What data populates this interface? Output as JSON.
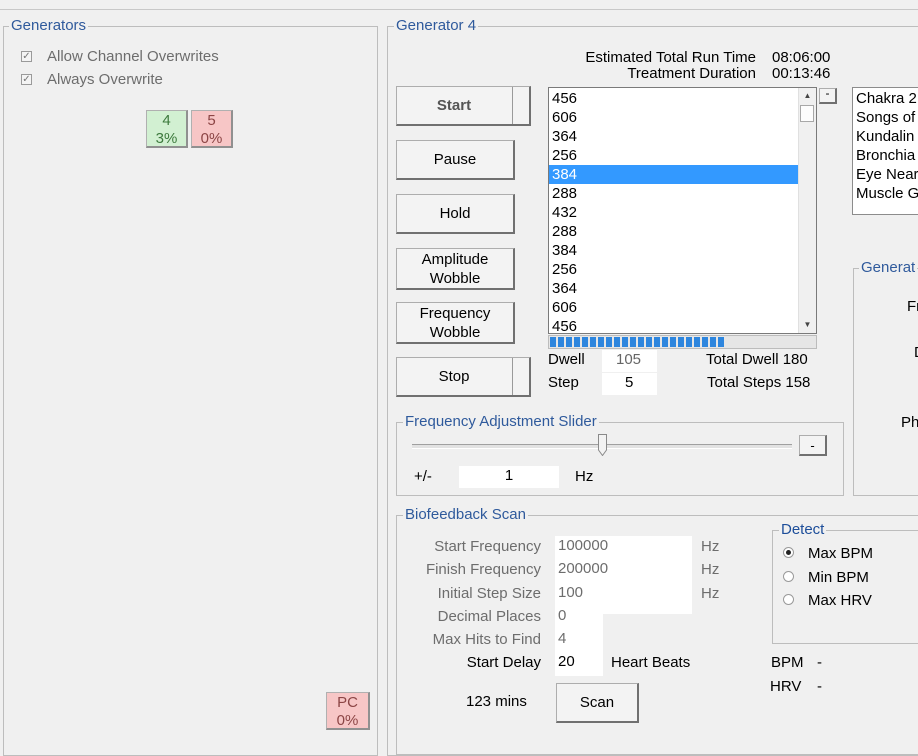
{
  "left_panel": {
    "title": "Generators",
    "checkboxes": [
      {
        "label": "Allow Channel Overwrites",
        "checked": true
      },
      {
        "label": "Always Overwrite",
        "checked": true
      }
    ],
    "channel_tiles": [
      {
        "num": "4",
        "pct": "3%",
        "color": "#d2f0d2"
      },
      {
        "num": "5",
        "pct": "0%",
        "color": "#f7c6c6"
      }
    ],
    "pc_tile": {
      "num": "PC",
      "pct": "0%"
    }
  },
  "generator": {
    "title": "Generator 4",
    "estimated_label": "Estimated Total Run Time",
    "estimated_value": "08:06:00",
    "duration_label": "Treatment Duration",
    "duration_value": "00:13:46",
    "buttons": {
      "start": "Start",
      "pause": "Pause",
      "hold": "Hold",
      "amp_line1": "Amplitude",
      "amp_line2": "Wobble",
      "freq_line1": "Frequency",
      "freq_line2": "Wobble",
      "stop": "Stop"
    },
    "frequency_list": [
      "456",
      "606",
      "364",
      "256",
      "384",
      "288",
      "432",
      "288",
      "384",
      "256",
      "364",
      "606",
      "456"
    ],
    "selected_index": 4,
    "minus_button": "-",
    "programs": [
      "Chakra 2",
      "Songs of",
      "Kundalin",
      "Bronchia",
      "Eye Near",
      "Muscle G"
    ],
    "progress_fraction": 0.66,
    "dwell_label": "Dwell",
    "dwell_value": "105",
    "total_dwell": "Total Dwell 180",
    "step_label": "Step",
    "step_value": "5",
    "total_steps": "Total Steps 158",
    "right_group_title": "Generat",
    "right_group_labels": [
      "Fr",
      "D",
      "Ph"
    ]
  },
  "slider": {
    "title": "Frequency Adjustment Slider",
    "plusminus": "+/-",
    "value": "1",
    "unit": "Hz",
    "minus_button": "-",
    "position_fraction": 0.5
  },
  "biofeedback": {
    "title": "Biofeedback Scan",
    "fields": [
      {
        "label": "Start Frequency",
        "value": "100000",
        "unit": "Hz"
      },
      {
        "label": "Finish Frequency",
        "value": "200000",
        "unit": "Hz"
      },
      {
        "label": "Initial Step Size",
        "value": "100",
        "unit": "Hz"
      },
      {
        "label": "Decimal Places",
        "value": "0",
        "unit": ""
      },
      {
        "label": "Max Hits to Find",
        "value": "4",
        "unit": ""
      }
    ],
    "start_delay_label": "Start Delay",
    "start_delay_value": "20",
    "start_delay_unit": "Heart Beats",
    "mins": "123 mins",
    "scan_button": "Scan",
    "detect_title": "Detect",
    "detect_options": [
      {
        "label": "Max BPM",
        "selected": true
      },
      {
        "label": "Min BPM",
        "selected": false
      },
      {
        "label": "Max HRV",
        "selected": false
      }
    ],
    "bpm_label": "BPM",
    "bpm_value": "-",
    "hrv_label": "HRV",
    "hrv_value": "-"
  }
}
